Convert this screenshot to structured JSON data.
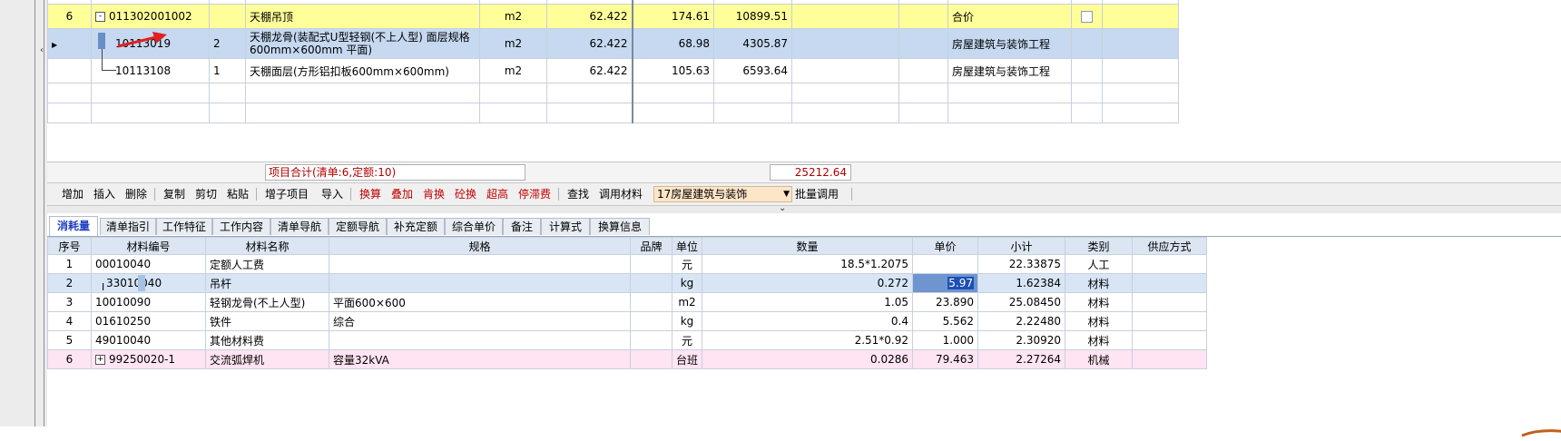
{
  "upper_grid": {
    "rows": [
      {
        "seq": "6",
        "code": "011302001002",
        "type": "",
        "name": "天棚吊顶",
        "unit": "m2",
        "qty": "62.422",
        "price": "174.61",
        "total": "10899.51",
        "c1": "",
        "c2": "",
        "category": "合价",
        "c3": "",
        "c4": "",
        "expand": "-"
      },
      {
        "seq": "",
        "code": "10113019",
        "type": "2",
        "name": "天棚龙骨(装配式U型轻钢(不上人型) 面层规格600mm×600mm 平面)",
        "unit": "m2",
        "qty": "62.422",
        "price": "68.98",
        "total": "4305.87",
        "c1": "",
        "c2": "",
        "category": "房屋建筑与装饰工程",
        "c3": "",
        "c4": ""
      },
      {
        "seq": "",
        "code": "10113108",
        "type": "1",
        "name": "天棚面层(方形铝扣板600mm×600mm)",
        "unit": "m2",
        "qty": "62.422",
        "price": "105.63",
        "total": "6593.64",
        "c1": "",
        "c2": "",
        "category": "房屋建筑与装饰工程",
        "c3": "",
        "c4": ""
      }
    ]
  },
  "summary": {
    "label": "项目合计(清单:6,定额:10)",
    "value": "25212.64"
  },
  "toolbar": {
    "add": "增加",
    "insert": "插入",
    "delete": "删除",
    "copy": "复制",
    "cut": "剪切",
    "paste": "粘贴",
    "add_subitem": "增子项目",
    "import": "导入",
    "convert": "换算",
    "stack": "叠加",
    "ken": "肯换",
    "concrete": "砼换",
    "super_high": "超高",
    "stagnation": "停滞费",
    "find": "查找",
    "use_material": "调用材料",
    "combo_value": "17房屋建筑与装饰",
    "batch": "批量调用"
  },
  "tabs": [
    "消耗量",
    "清单指引",
    "工作特征",
    "工作内容",
    "清单导航",
    "定额导航",
    "补充定额",
    "综合单价",
    "备注",
    "计算式",
    "换算信息"
  ],
  "materials": {
    "headers": [
      "序号",
      "材料编号",
      "材料名称",
      "规格",
      "品牌",
      "单位",
      "数量",
      "单价",
      "小计",
      "类别",
      "供应方式"
    ],
    "rows": [
      {
        "seq": "1",
        "code": "00010040",
        "name": "定额人工费",
        "spec": "",
        "brand": "",
        "unit": "元",
        "qty": "18.5*1.2075",
        "price": "",
        "subtotal": "22.33875",
        "category": "人工",
        "supply": ""
      },
      {
        "seq": "2",
        "code": "33010040",
        "name": "吊杆",
        "spec": "",
        "brand": "",
        "unit": "kg",
        "qty": "0.272",
        "price": "5.97",
        "subtotal": "1.62384",
        "category": "材料",
        "supply": ""
      },
      {
        "seq": "3",
        "code": "10010090",
        "name": "轻钢龙骨(不上人型)",
        "spec": "平面600×600",
        "brand": "",
        "unit": "m2",
        "qty": "1.05",
        "price": "23.890",
        "subtotal": "25.08450",
        "category": "材料",
        "supply": ""
      },
      {
        "seq": "4",
        "code": "01610250",
        "name": "铁件",
        "spec": "综合",
        "brand": "",
        "unit": "kg",
        "qty": "0.4",
        "price": "5.562",
        "subtotal": "2.22480",
        "category": "材料",
        "supply": ""
      },
      {
        "seq": "5",
        "code": "49010040",
        "name": "其他材料费",
        "spec": "",
        "brand": "",
        "unit": "元",
        "qty": "2.51*0.92",
        "price": "1.000",
        "subtotal": "2.30920",
        "category": "材料",
        "supply": ""
      },
      {
        "seq": "6",
        "code": "99250020-1",
        "name": "交流弧焊机",
        "spec": "容量32kVA",
        "brand": "",
        "unit": "台班",
        "qty": "0.0286",
        "price": "79.463",
        "subtotal": "2.27264",
        "category": "机械",
        "supply": "",
        "expand": "+"
      }
    ]
  },
  "colors": {
    "highlight_yellow": "#ffff99",
    "selected_blue": "#c6d9f1",
    "machine_pink": "#ffe4f3",
    "red_text": "#c00000",
    "annotation_arrow": "#e02020"
  },
  "icons": {
    "pointer": "row-pointer-icon",
    "arrow": "red-arrow-annotation-icon",
    "splitter": "chevron-down-icon",
    "watermark": "panda-watermark-icon"
  }
}
